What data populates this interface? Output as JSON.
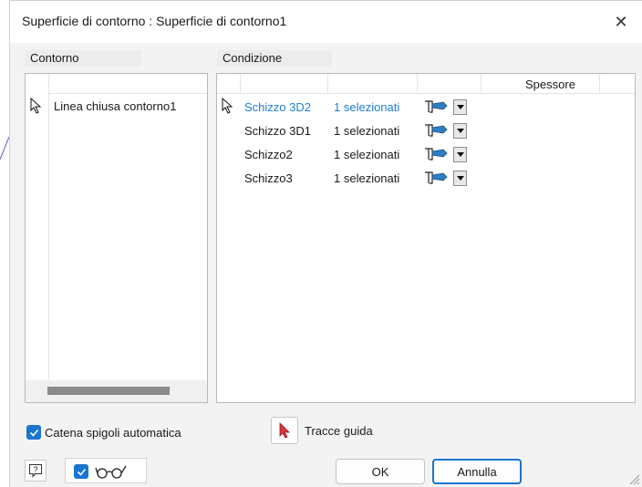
{
  "dialog": {
    "title": "Superficie di contorno : Superficie di contorno1",
    "close_glyph": "✕"
  },
  "contorno": {
    "label": "Contorno",
    "items": [
      {
        "label": "Linea chiusa contorno1",
        "icon": "select-cursor-icon"
      }
    ]
  },
  "condizione": {
    "label": "Condizione",
    "column_spessore": "Spessore",
    "rows": [
      {
        "name": "Schizzo 3D2",
        "count": "1 selezionati",
        "active": true
      },
      {
        "name": "Schizzo 3D1",
        "count": "1 selezionati",
        "active": false
      },
      {
        "name": "Schizzo2",
        "count": "1 selezionati",
        "active": false
      },
      {
        "name": "Schizzo3",
        "count": "1 selezionati",
        "active": false
      }
    ]
  },
  "options": {
    "chain_label": "Catena spigoli automatica",
    "chain_checked": true,
    "guide_label": "Tracce guida",
    "preview_checked": true
  },
  "buttons": {
    "ok": "OK",
    "cancel": "Annulla"
  },
  "colors": {
    "accent": "#1b74d0",
    "active_row_text": "#1f7fd1"
  }
}
